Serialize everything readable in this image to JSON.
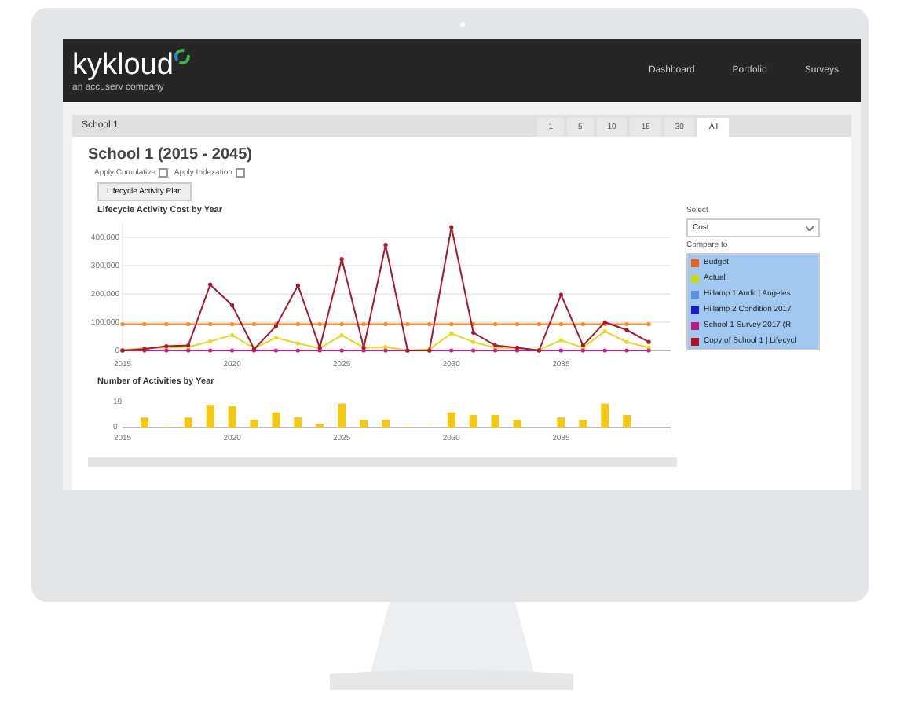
{
  "app": {
    "logo": "kykloud",
    "tagline": "an accuserv company",
    "nav": [
      "Dashboard",
      "Portfolio",
      "Surveys"
    ]
  },
  "tabbar": {
    "title": "School 1",
    "tabs": [
      {
        "label": "1",
        "selected": false
      },
      {
        "label": "5",
        "selected": false
      },
      {
        "label": "10",
        "selected": false
      },
      {
        "label": "15",
        "selected": false
      },
      {
        "label": "30",
        "selected": false
      },
      {
        "label": "All",
        "selected": true
      }
    ]
  },
  "heading": "School 1 (2015 - 2045)",
  "options": [
    {
      "label": "Apply Cumulative",
      "checked": false
    },
    {
      "label": "Apply Indexation",
      "checked": false
    }
  ],
  "plan_button": "Lifecycle Activity Plan",
  "cost_chart": {
    "chart_data": {
      "type": "line",
      "title": "Lifecycle Activity Cost by Year",
      "x": [
        2015,
        2016,
        2017,
        2018,
        2019,
        2020,
        2021,
        2022,
        2023,
        2024,
        2025,
        2026,
        2027,
        2028,
        2029,
        2030,
        2031,
        2032,
        2033,
        2034,
        2035,
        2036,
        2037,
        2038,
        2039
      ],
      "xlim": [
        2015,
        2040
      ],
      "ylim": [
        0,
        450000
      ],
      "grid": true,
      "xticks": [
        2015,
        2020,
        2025,
        2030,
        2035
      ],
      "yticks": [
        {
          "value": 0,
          "label": "0"
        },
        {
          "value": 100000,
          "label": "100,000"
        },
        {
          "value": 200000,
          "label": "200,000"
        },
        {
          "value": 300000,
          "label": "300,000"
        },
        {
          "value": 400000,
          "label": "400,000"
        }
      ],
      "series": [
        {
          "color": "#f08a2c",
          "values": [
            93000,
            93000,
            93000,
            93000,
            93000,
            93000,
            93000,
            93000,
            93000,
            93000,
            93000,
            93000,
            93000,
            93000,
            93000,
            93000,
            93000,
            93000,
            93000,
            93000,
            93000,
            93000,
            93000,
            93000,
            93000
          ]
        },
        {
          "color": "#e6d81c",
          "values": [
            2000,
            8000,
            10000,
            12000,
            32000,
            54000,
            8000,
            45000,
            25000,
            8000,
            54000,
            10000,
            12000,
            0,
            5000,
            60000,
            30000,
            10000,
            8000,
            2000,
            36000,
            10000,
            68000,
            30000,
            10000
          ]
        },
        {
          "color": "#c0208a",
          "values": [
            0,
            0,
            0,
            0,
            0,
            0,
            0,
            0,
            0,
            0,
            0,
            0,
            0,
            0,
            0,
            0,
            0,
            0,
            0,
            0,
            0,
            0,
            0,
            0,
            0
          ]
        },
        {
          "color": "#a8182e",
          "values": [
            0,
            5000,
            15000,
            18000,
            233000,
            160000,
            5000,
            86000,
            230000,
            10000,
            323000,
            10000,
            373000,
            0,
            0,
            436000,
            63000,
            18000,
            10000,
            0,
            197000,
            18000,
            100000,
            72000,
            30000
          ]
        }
      ]
    }
  },
  "side": {
    "select_label": "Select",
    "select_value": "Cost",
    "compare_label": "Compare to",
    "compare": [
      {
        "label": "Budget",
        "color": "#e8641e",
        "selected": true
      },
      {
        "label": "Actual",
        "color": "#c8d818",
        "selected": true
      },
      {
        "label": "Hillamp 1 Audit | Angeles",
        "color": "#5b8fd6",
        "selected": true
      },
      {
        "label": "Hillamp 2 Condition 2017",
        "color": "#1a1ad0",
        "selected": true
      },
      {
        "label": "School 1 Survey 2017 (R",
        "color": "#c0187a",
        "selected": true
      },
      {
        "label": "Copy of School 1 | Lifecycl",
        "color": "#b01020",
        "selected": true
      }
    ]
  },
  "count_chart": {
    "chart_data": {
      "type": "bar",
      "title": "Number of Activities by Year",
      "x": [
        2015,
        2016,
        2017,
        2018,
        2019,
        2020,
        2021,
        2022,
        2023,
        2024,
        2025,
        2026,
        2027,
        2028,
        2029,
        2030,
        2031,
        2032,
        2033,
        2034,
        2035,
        2036,
        2037,
        2038,
        2039
      ],
      "xlim": [
        2015,
        2040
      ],
      "values": [
        0,
        4,
        0.3,
        4,
        9,
        8.5,
        3,
        6,
        4,
        1.5,
        9.5,
        3,
        3,
        0.2,
        0.2,
        6,
        5,
        5,
        3,
        0,
        4,
        3,
        9.5,
        5,
        0
      ],
      "ylim": [
        0,
        10
      ],
      "yticks": [
        0,
        10
      ],
      "xticks": [
        2015,
        2020,
        2025,
        2030,
        2035
      ]
    }
  }
}
